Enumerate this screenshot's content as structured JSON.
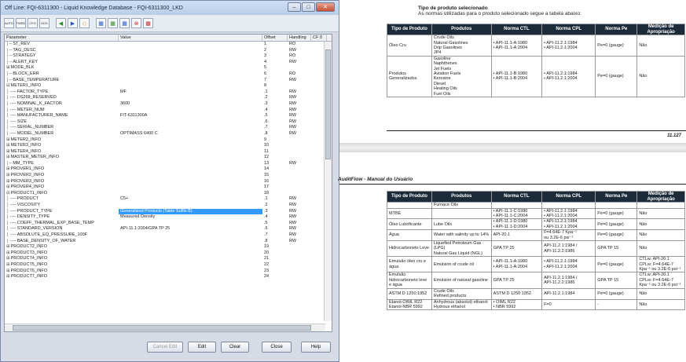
{
  "window": {
    "title": "Off Line: FQI-6311300 - Liquid Knowledge Database - FQI-6311300_LKD",
    "toolbar": [
      "AUTO",
      "FWRD",
      "CFG",
      "DDS",
      "◀",
      "▶",
      "◇",
      "▦",
      "▦",
      "▦",
      "⊗",
      "▦"
    ],
    "columns": [
      "Parameter",
      "Value",
      "Offset",
      "Handling",
      "CF 0"
    ],
    "rows": [
      {
        "p": "ST_REV",
        "v": "",
        "o": "1",
        "h": "RO",
        "ind": 1
      },
      {
        "p": "TAG_DESC",
        "v": "",
        "o": "2",
        "h": "RW",
        "ind": 1
      },
      {
        "p": "STRATEGY",
        "v": "",
        "o": "3",
        "h": "RO",
        "ind": 1
      },
      {
        "p": "ALERT_KEY",
        "v": "",
        "o": "4",
        "h": "RW",
        "ind": 1
      },
      {
        "p": "MODE_BLK",
        "v": "",
        "o": "5",
        "h": "",
        "ind": 0,
        "exp": "+"
      },
      {
        "p": "BLOCK_ERR",
        "v": "",
        "o": "6",
        "h": "RO",
        "ind": 1
      },
      {
        "p": "BASE_TEMPERATURE",
        "v": "",
        "o": "7",
        "h": "RW",
        "ind": 1
      },
      {
        "p": "METER1_INFO",
        "v": "",
        "o": "8",
        "h": "",
        "ind": 0,
        "exp": "-"
      },
      {
        "p": "FACTOR_TYPE",
        "v": "MF",
        "o": ".1",
        "h": "RW",
        "ind": 2
      },
      {
        "p": "DS268_RESERVED",
        "v": "",
        "o": ".2",
        "h": "RW",
        "ind": 2
      },
      {
        "p": "NOMINAL_K_FACTOR",
        "v": "3600",
        "o": ".3",
        "h": "RW",
        "ind": 2
      },
      {
        "p": "METER_NUM",
        "v": "",
        "o": ".4",
        "h": "RW",
        "ind": 2
      },
      {
        "p": "MANUFACTURER_NAME",
        "v": "FIT-6311300A",
        "o": ".5",
        "h": "RW",
        "ind": 2
      },
      {
        "p": "SIZE",
        "v": "",
        "o": ".6",
        "h": "RW",
        "ind": 2
      },
      {
        "p": "SERIAL_NUMBER",
        "v": "",
        "o": ".7",
        "h": "RW",
        "ind": 2
      },
      {
        "p": "MODEL_NUMBER",
        "v": "OPTIMASS 6400 C",
        "o": ".8",
        "h": "RW",
        "ind": 2
      },
      {
        "p": "METER2_INFO",
        "v": "",
        "o": "9",
        "h": "",
        "ind": 0,
        "exp": "+"
      },
      {
        "p": "METER3_INFO",
        "v": "",
        "o": "10",
        "h": "",
        "ind": 0,
        "exp": "+"
      },
      {
        "p": "METER4_INFO",
        "v": "",
        "o": "11",
        "h": "",
        "ind": 0,
        "exp": "+"
      },
      {
        "p": "MASTER_METER_INFO",
        "v": "",
        "o": "12",
        "h": "",
        "ind": 0,
        "exp": "+"
      },
      {
        "p": "MM_TYPE",
        "v": "",
        "o": "13",
        "h": "RW",
        "ind": 1
      },
      {
        "p": "PROVER1_INFO",
        "v": "",
        "o": "14",
        "h": "",
        "ind": 0,
        "exp": "+"
      },
      {
        "p": "PROVER2_INFO",
        "v": "",
        "o": "15",
        "h": "",
        "ind": 0,
        "exp": "+"
      },
      {
        "p": "PROVER3_INFO",
        "v": "",
        "o": "16",
        "h": "",
        "ind": 0,
        "exp": "+"
      },
      {
        "p": "PROVER4_INFO",
        "v": "",
        "o": "17",
        "h": "",
        "ind": 0,
        "exp": "+"
      },
      {
        "p": "PRODUCT1_INFO",
        "v": "",
        "o": "18",
        "h": "",
        "ind": 0,
        "exp": "-"
      },
      {
        "p": "PRODUCT",
        "v": "C5+",
        "o": ".1",
        "h": "RW",
        "ind": 2
      },
      {
        "p": "VISCOSITY",
        "v": "",
        "o": ".2",
        "h": "RW",
        "ind": 2
      },
      {
        "p": "PRODUCT_TYPE",
        "v": "Generalized Products (Table Suffix B)",
        "o": ".3",
        "h": "RW",
        "ind": 2,
        "sel": true
      },
      {
        "p": "DENSITY_TYPE",
        "v": "Measured Density",
        "o": ".4",
        "h": "RW",
        "ind": 2
      },
      {
        "p": "COEFF_THERMAL_EXP_BASE_TEMP",
        "v": "",
        "o": ".5",
        "h": "RW",
        "ind": 2
      },
      {
        "p": "STANDARD_VERSION",
        "v": "API-11.1:2004/GPA TP 25",
        "o": ".6",
        "h": "RW",
        "ind": 2
      },
      {
        "p": "ABSOLUTE_EQ_PRESSURE_100F",
        "v": "",
        "o": ".7",
        "h": "RW",
        "ind": 2
      },
      {
        "p": "BASE_DENSITY_OF_WATER",
        "v": "",
        "o": ".8",
        "h": "RW",
        "ind": 2
      },
      {
        "p": "PRODUCT2_INFO",
        "v": "",
        "o": "19",
        "h": "",
        "ind": 0,
        "exp": "+"
      },
      {
        "p": "PRODUCT3_INFO",
        "v": "",
        "o": "20",
        "h": "",
        "ind": 0,
        "exp": "+"
      },
      {
        "p": "PRODUCT4_INFO",
        "v": "",
        "o": "21",
        "h": "",
        "ind": 0,
        "exp": "+"
      },
      {
        "p": "PRODUCT5_INFO",
        "v": "",
        "o": "22",
        "h": "",
        "ind": 0,
        "exp": "+"
      },
      {
        "p": "PRODUCT6_INFO",
        "v": "",
        "o": "23",
        "h": "",
        "ind": 0,
        "exp": "+"
      },
      {
        "p": "PRODUCT7_INFO",
        "v": "",
        "o": "24",
        "h": "",
        "ind": 0,
        "exp": "+"
      }
    ],
    "buttons": {
      "cancel_edit": "Cancel Edit",
      "edit": "Edit",
      "clear": "Clear",
      "close": "Close",
      "help": "Help"
    }
  },
  "doc": {
    "sec1_title": "Tipo de produto selecionado",
    "sec1_sub": "As normas utilizadas para o produto selecionado segue a tabela abaixo:",
    "headers": [
      "Tipo de Produto",
      "Produtos",
      "Norma CTL",
      "Norma CPL",
      "Norma Pe",
      "Medição de Apropriação"
    ],
    "table1": [
      {
        "tipo": "Óleo Cru",
        "prod": [
          "Crude Oils",
          "Natural Gasolines",
          "Drip Gasolines",
          "JP4"
        ],
        "ctl": [
          "API-11.1-A:1980",
          "API-11.1-A:2004"
        ],
        "cpl": [
          "API-11.2.1:1984",
          "API-11.2.1:2004"
        ],
        "pe": "Pe=0 (gauge)",
        "med": "Não"
      },
      {
        "tipo": "Produtos Generalizados",
        "prod": [
          "Gasoline",
          "Naphthenes",
          "Jet Fuels",
          "Aviation Fuels",
          "Kerosine",
          "Diesel",
          "Heating Oils",
          "Fuel Oils"
        ],
        "ctl": [
          "API-11.1-B:1980",
          "API-11.1-B:2004"
        ],
        "cpl": [
          "API-11.2.1:1984",
          "API-11.2.1:2004"
        ],
        "pe": "Pe=0 (gauge)",
        "med": "Não"
      }
    ],
    "page_num": "11.127",
    "doc_title": "AuditFlow - Manual do Usuário",
    "table2": [
      {
        "tipo": "",
        "prod": [
          "Furnace Oils"
        ],
        "ctl": [],
        "cpl": [],
        "pe": "",
        "med": ""
      },
      {
        "tipo": "MTBE",
        "prod": [],
        "ctl": [
          "API-11.1-C:1980",
          "API-11.1-C:2004"
        ],
        "cpl": [
          "API-11.2.1:1984",
          "API-11.2.1:2004"
        ],
        "pe": "Pe=0 (gauge)",
        "med": "Não"
      },
      {
        "tipo": "Óleo Lubrificante",
        "prod": [
          "Lube Oils"
        ],
        "ctl": [
          "API-11.1-D:1980",
          "API-11.1-D:2004"
        ],
        "cpl": [
          "API-11.2.1:1984",
          "API-11.2.1:2004"
        ],
        "pe": "Pe=0 (gauge)",
        "med": "Não"
      },
      {
        "tipo": "Água",
        "prod": [
          "Water with salinity up to 14%"
        ],
        "ctl": [
          "API-20.1"
        ],
        "cpl": [
          "F=4.64E-7 Kpa⁻¹",
          "ou 3.2E-6 psi⁻¹"
        ],
        "pe": "Pe=0 (gauge)",
        "med": "Não",
        "plain": true
      },
      {
        "tipo": "Hidrocarboneto Leve",
        "prod": [
          "Liquefied Petroleum Gas (LPG)",
          "Natural Gas Liquid (NGL)"
        ],
        "ctl": [
          "GPA TP 25"
        ],
        "cpl": [
          "API-11.2.1:1984 /",
          "API-11.2.2:1986"
        ],
        "pe": "GPA TP 15",
        "med": "Não",
        "plain": true
      },
      {
        "tipo": "Emulsão óleo cru e água",
        "prod": [
          "Emulsion of crude oil"
        ],
        "ctl": [
          "API-11.1-A:1980",
          "API-11.1-A:2004"
        ],
        "cpl": [
          "API-11.2.1:1984",
          "API-11.2.1:2004"
        ],
        "pe": "Pe=0 (gauge)",
        "med": "CTLw: API-20.1 CPLw: F=4.64E-7 Kpa⁻¹ ou 3.2E-6 psi⁻¹"
      },
      {
        "tipo": "Emulsão hidrocarboneto leve e água",
        "prod": [
          "Emulsion of natural gasoline"
        ],
        "ctl": [
          "GPA TP 25"
        ],
        "cpl": [
          "API-11.2.1:1984 /",
          "API-11.2.2:1986"
        ],
        "pe": "GPA TP 15",
        "med": "CTLw: API-20.1 CPLw: F=4.64E-7 Kpa⁻¹ ou 3.2E-6 psi⁻¹",
        "plain": true
      },
      {
        "tipo": "ASTM D 1250:1952",
        "prod": [
          "Crude Oils",
          "Refined products"
        ],
        "ctl": [
          "ASTM D 1250:1952"
        ],
        "cpl": [
          "API-11.2.1:1984"
        ],
        "pe": "Pe=0 (gauge)",
        "med": "Não",
        "plain": true
      },
      {
        "tipo": "Etanol-OIML R22 Etanol-NBR 5992",
        "prod": [
          "Anhydrous (absolut) ethanol",
          "Hydrous ethanol"
        ],
        "ctl": [
          "OIML R22",
          "NBR 5992"
        ],
        "cpl": [
          "F=0"
        ],
        "pe": "-",
        "med": "Não",
        "ctlbul": true
      }
    ]
  }
}
